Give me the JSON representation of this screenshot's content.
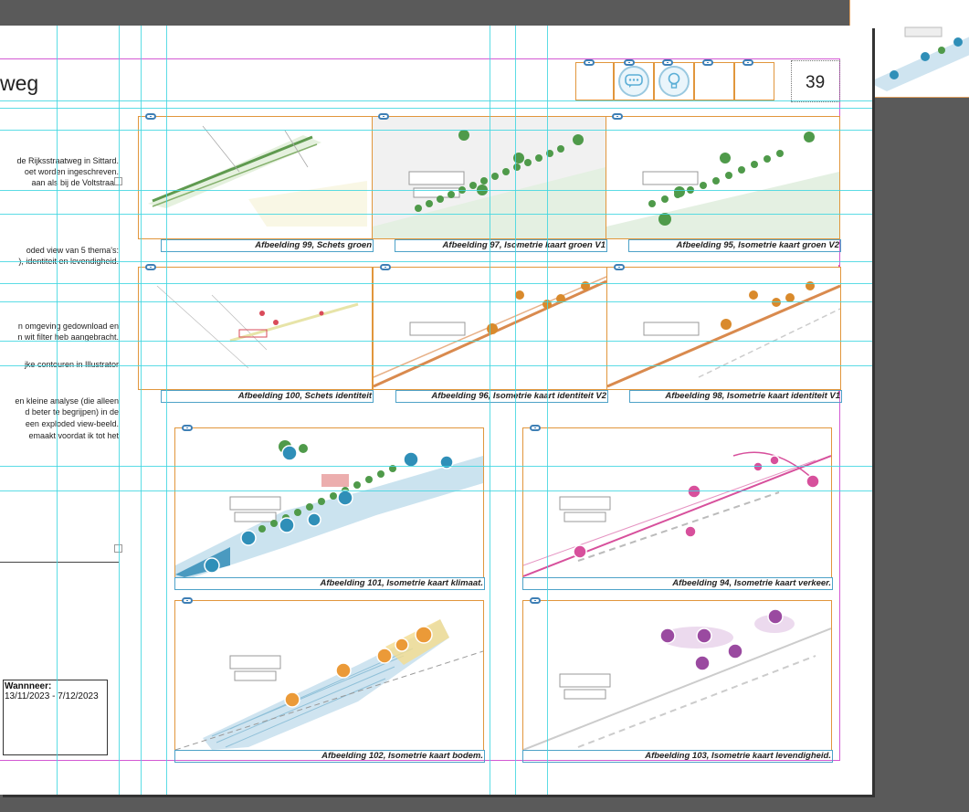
{
  "page": {
    "heading": "weg",
    "page_number": "39"
  },
  "body_text": [
    "de Rijksstraatweg in Sittard.",
    "oet worden ingeschreven.",
    "aan als bij de Voltstraat.",
    "oded view van 5 thema's:",
    "), identiteit en levendigheid.",
    "n omgeving gedownload en",
    "n wit filter heb aangebracht.",
    "jke contouren in Illustrator",
    "en kleine analyse (die alleen",
    "d beter te begrijpen) in de",
    "een exploded view-beeld.",
    "emaakt voordat ik tot het"
  ],
  "date_box": {
    "label": "Wannneer:",
    "value": "13/11/2023 - 7/12/2023"
  },
  "captions": {
    "c99": "Afbeelding 99, Schets groen",
    "c97": "Afbeelding 97, Isometrie kaart groen V1",
    "c95": "Afbeelding 95, Isometrie kaart groen V2",
    "c100": "Afbeelding 100, Schets identiteit",
    "c96": "Afbeelding 96, Isometrie kaart identiteit V2",
    "c98": "Afbeelding 98, Isometrie kaart identiteit V1",
    "c101": "Afbeelding 101, Isometrie kaart klimaat.",
    "c94": "Afbeelding 94, Isometrie kaart verkeer.",
    "c102": "Afbeelding 102, Isometrie kaart bodem.",
    "c103": "Afbeelding 103, Isometrie kaart levendigheid."
  },
  "icons": {
    "link": "link-icon",
    "speech": "speech-bubble-icon",
    "bulb": "lightbulb-icon"
  },
  "colors": {
    "guide": "#3fd6e0",
    "margin": "#d35ad3",
    "frame": "#e1963c",
    "caption_frame": "#4ea2c8",
    "green": "#4f9a4a",
    "orange": "#e08a2c",
    "blue": "#2f8fb8",
    "pink": "#d7509c",
    "purple": "#9a4aa0"
  }
}
